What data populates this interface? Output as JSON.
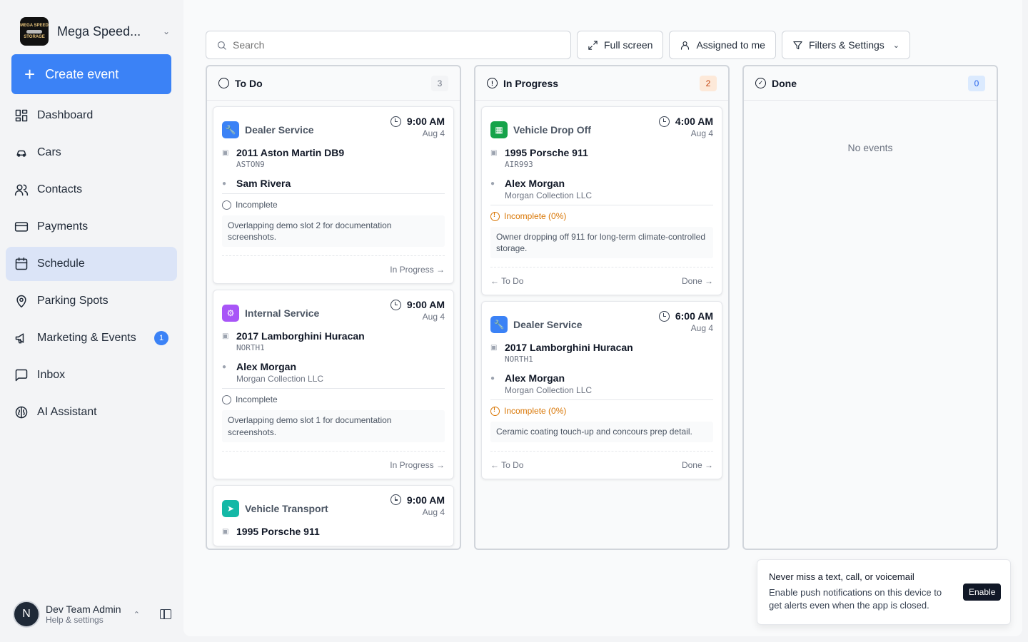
{
  "sidebar": {
    "org_name": "Mega Speed...",
    "logo_text": [
      "MEGA SPEED",
      "STORAGE"
    ],
    "create_label": "Create event",
    "items": [
      {
        "label": "Dashboard"
      },
      {
        "label": "Cars"
      },
      {
        "label": "Contacts"
      },
      {
        "label": "Payments"
      },
      {
        "label": "Schedule",
        "active": true
      },
      {
        "label": "Parking Spots"
      },
      {
        "label": "Marketing & Events",
        "badge": "1"
      },
      {
        "label": "Inbox"
      },
      {
        "label": "AI Assistant"
      }
    ],
    "user": {
      "initial": "N",
      "name": "Dev Team Admin",
      "sub": "Help & settings"
    }
  },
  "toolbar": {
    "search_placeholder": "Search",
    "fullscreen_label": "Full screen",
    "assigned_label": "Assigned to me",
    "filters_label": "Filters & Settings"
  },
  "columns": [
    {
      "title": "To Do",
      "count": "3",
      "cards": [
        {
          "type": "Dealer Service",
          "time": "9:00 AM",
          "date": "Aug 4",
          "car": "2011 Aston Martin DB9",
          "plate": "ASTON9",
          "person": "Sam Rivera",
          "company": "",
          "status": "Incomplete",
          "note": "Overlapping demo slot 2 for documentation screenshots.",
          "action_right": "In Progress"
        },
        {
          "type": "Internal Service",
          "time": "9:00 AM",
          "date": "Aug 4",
          "car": "2017 Lamborghini Huracan",
          "plate": "NORTH1",
          "person": "Alex Morgan",
          "company": "Morgan Collection LLC",
          "status": "Incomplete",
          "note": "Overlapping demo slot 1 for documentation screenshots.",
          "action_right": "In Progress"
        },
        {
          "type": "Vehicle Transport",
          "time": "9:00 AM",
          "date": "Aug 4",
          "car": "1995 Porsche 911"
        }
      ]
    },
    {
      "title": "In Progress",
      "count": "2",
      "cards": [
        {
          "type": "Vehicle Drop Off",
          "time": "4:00 AM",
          "date": "Aug 4",
          "car": "1995 Porsche 911",
          "plate": "AIR993",
          "person": "Alex Morgan",
          "company": "Morgan Collection LLC",
          "status": "Incomplete (0%)",
          "note": "Owner dropping off 911 for long-term climate-controlled storage.",
          "action_left": "To Do",
          "action_right": "Done"
        },
        {
          "type": "Dealer Service",
          "time": "6:00 AM",
          "date": "Aug 4",
          "car": "2017 Lamborghini Huracan",
          "plate": "NORTH1",
          "person": "Alex Morgan",
          "company": "Morgan Collection LLC",
          "status": "Incomplete (0%)",
          "note": "Ceramic coating touch-up and concours prep detail.",
          "action_left": "To Do",
          "action_right": "Done"
        }
      ]
    },
    {
      "title": "Done",
      "count": "0",
      "empty_text": "No events"
    }
  ],
  "toast": {
    "title": "Never miss a text, call, or voicemail",
    "body": "Enable push notifications on this device to get alerts even when the app is closed.",
    "button": "Enable"
  },
  "colors": {
    "accent": "#3b82f6",
    "dealer_service": "#3b82f6",
    "internal_service": "#a855f7",
    "vehicle_transport": "#14b8a6",
    "vehicle_drop_off": "#16a34a",
    "warning": "#d97706"
  }
}
